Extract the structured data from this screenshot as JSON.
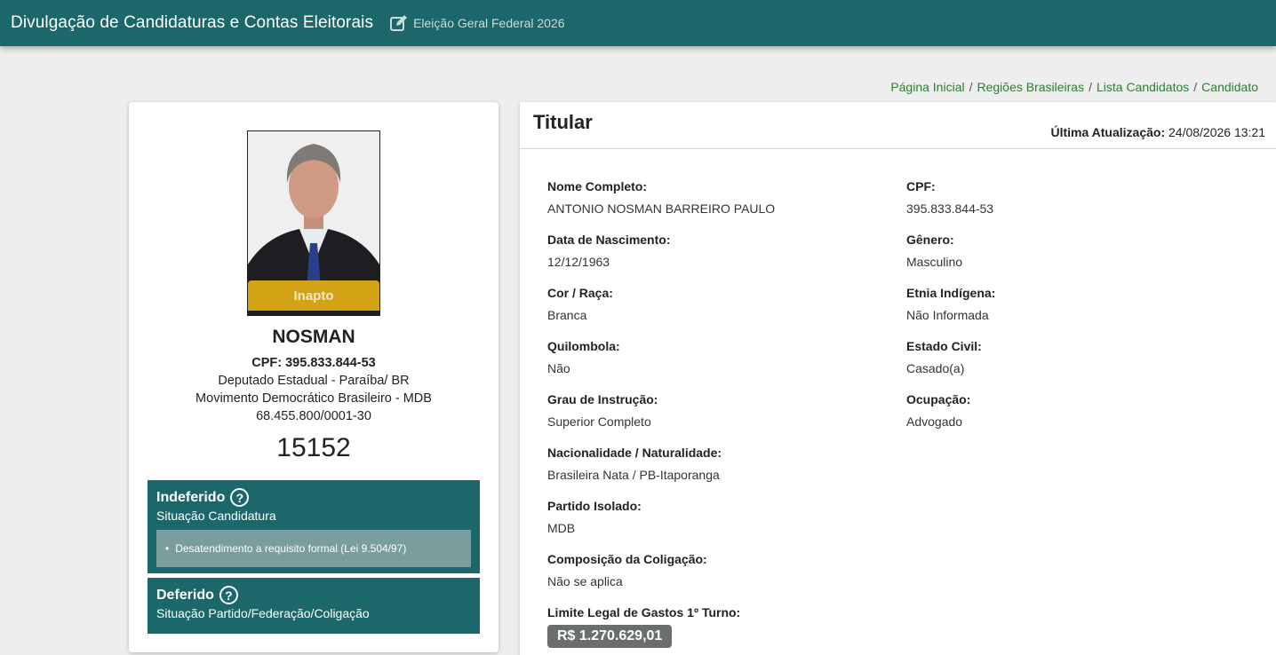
{
  "header": {
    "title": "Divulgação de Candidaturas e Contas Eleitorais",
    "election": "Eleição Geral Federal 2026"
  },
  "breadcrumb": [
    "Página Inicial",
    "Regiões Brasileiras",
    "Lista Candidatos",
    "Candidato"
  ],
  "candidate": {
    "status": "Inapto",
    "name": "NOSMAN",
    "cpf_line": "CPF: 395.833.844-53",
    "office": "Deputado Estadual - Paraíba/ BR",
    "party": "Movimento Democrático Brasileiro - MDB",
    "cnpj": "68.455.800/0001-30",
    "number": "15152"
  },
  "situations": [
    {
      "title": "Indeferido",
      "subtitle": "Situação Candidatura",
      "reason": "Desatendimento a requisito formal (Lei 9.504/97)"
    },
    {
      "title": "Deferido",
      "subtitle": "Situação Partido/Federação/Coligação"
    }
  ],
  "details": {
    "section_title": "Titular",
    "updated_label": "Última Atualização:",
    "updated_value": "24/08/2026 13:21",
    "fields": [
      {
        "label": "Nome Completo:",
        "value": "ANTONIO NOSMAN BARREIRO PAULO"
      },
      {
        "label": "CPF:",
        "value": "395.833.844-53"
      },
      {
        "label": "Data de Nascimento:",
        "value": "12/12/1963"
      },
      {
        "label": "Gênero:",
        "value": "Masculino"
      },
      {
        "label": "Cor / Raça:",
        "value": "Branca"
      },
      {
        "label": "Etnia Indígena:",
        "value": "Não Informada"
      },
      {
        "label": "Quilombola:",
        "value": "Não"
      },
      {
        "label": "Estado Civil:",
        "value": "Casado(a)"
      },
      {
        "label": "Grau de Instrução:",
        "value": "Superior Completo"
      },
      {
        "label": "Ocupação:",
        "value": "Advogado"
      },
      {
        "label": "Nacionalidade / Naturalidade:",
        "value": "Brasileira Nata / PB-Itaporanga"
      },
      {
        "label": "Partido Isolado:",
        "value": "MDB"
      },
      {
        "label": "Composição da Coligação:",
        "value": "Não se aplica"
      },
      {
        "label": "Limite Legal de Gastos 1º Turno:",
        "value": "R$ 1.270.629,01"
      }
    ]
  },
  "colors": {
    "primary": "#1c6769",
    "status_inapto": "#d4a215",
    "breadcrumb_link": "#2e7d32",
    "money_badge": "#6b6e6e"
  }
}
